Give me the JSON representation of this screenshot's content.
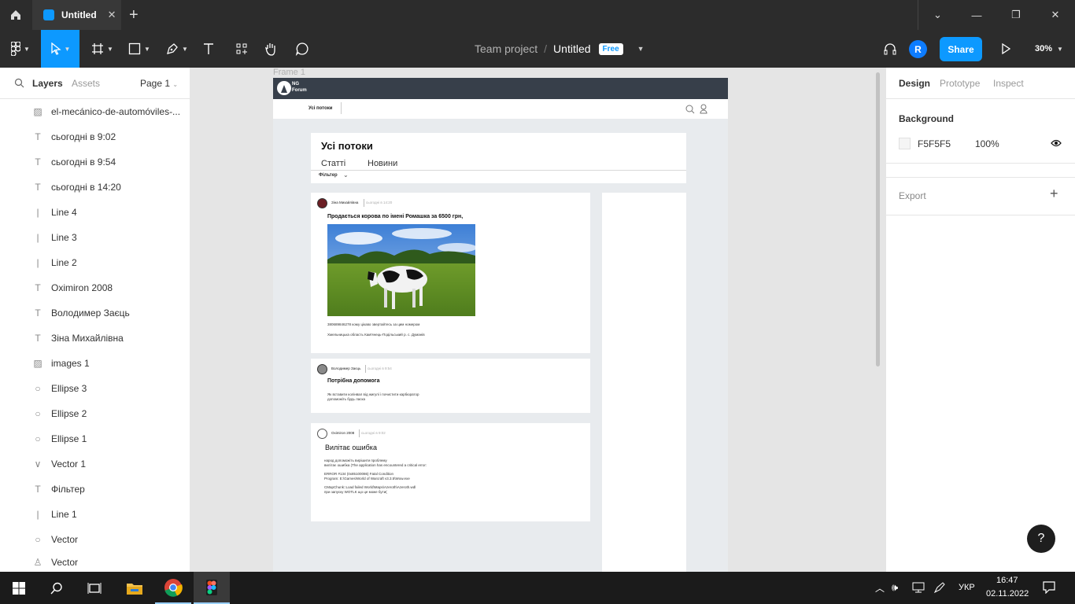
{
  "titlebar": {
    "tab_label": "Untitled",
    "tab_close": "✕",
    "new_tab": "+",
    "min": "—",
    "max": "❐",
    "close": "✕"
  },
  "toolbar": {
    "team": "Team project",
    "sep": "/",
    "file": "Untitled",
    "plan_badge": "Free",
    "avatar_initial": "R",
    "share_label": "Share",
    "zoom": "30%"
  },
  "left_panel": {
    "tab_layers": "Layers",
    "tab_assets": "Assets",
    "page": "Page 1",
    "layers": [
      {
        "icon": "image-icon",
        "label": "el-mecánico-de-automóviles-..."
      },
      {
        "icon": "text-icon",
        "label": "сьогодні в 9:02"
      },
      {
        "icon": "text-icon",
        "label": "сьогодні в 9:54"
      },
      {
        "icon": "text-icon",
        "label": "сьогодні в 14:20"
      },
      {
        "icon": "line-icon",
        "label": "Line 4"
      },
      {
        "icon": "line-icon",
        "label": "Line 3"
      },
      {
        "icon": "line-icon",
        "label": "Line 2"
      },
      {
        "icon": "text-icon",
        "label": "Oximiron 2008"
      },
      {
        "icon": "text-icon",
        "label": "Володимер Заєць"
      },
      {
        "icon": "text-icon",
        "label": "Зіна Михайлівна"
      },
      {
        "icon": "image-icon",
        "label": "images 1"
      },
      {
        "icon": "ellipse-icon",
        "label": "Ellipse 3"
      },
      {
        "icon": "ellipse-icon",
        "label": "Ellipse 2"
      },
      {
        "icon": "ellipse-icon",
        "label": "Ellipse 1"
      },
      {
        "icon": "vector-icon",
        "label": "Vector 1"
      },
      {
        "icon": "text-icon",
        "label": "Фільтер"
      },
      {
        "icon": "line-icon",
        "label": "Line 1"
      },
      {
        "icon": "search-icon",
        "label": "Vector"
      },
      {
        "icon": "user-icon",
        "label": "Vector"
      }
    ]
  },
  "canvas": {
    "frame_label": "Frame 1",
    "site": {
      "logo_line1": "NG",
      "logo_line2": "Forum",
      "nav_all": "Усі потоки",
      "page_title": "Усі потоки",
      "tab_articles": "Статті",
      "tab_news": "Новини",
      "filter": "Фільтер",
      "posts": [
        {
          "author": "Зіна Михайлівна",
          "time": "сьогодні в 14:20",
          "title": "Продається корова по імені Ромашка за 6500 грн,",
          "line1": "380689846278 кому цікаво звертайтесь за цим номером",
          "line2": "Хмельницька область Кам'янець-Подільський р. с. Думанів"
        },
        {
          "author": "Володимер Заєць",
          "time": "сьогодні в 9:54",
          "title": "Потрібна допомога",
          "line1": "Як вставити колінвал від жигулі і почистити карбюратор",
          "line2": "допоможіть будь ласка"
        },
        {
          "author": "Oximiron 2008",
          "time": "сьогодні в 9:02",
          "title": "Вилітає ошибка",
          "line1": "народ допоможіть вирішити проблему",
          "line2": "вилітає ошибка (The application has encountered a critical error:",
          "line3": "ERROR #134 (0x85100086) Fatal Condition",
          "line4": "Program: E:\\Games\\World of Warcraft v3.3.5\\Wow.exe",
          "line5": "CMapChunk::Load failed World\\Maps\\Azeroth\\Azeroth.wdl",
          "line6": "при запуску WOTLK що це може бути("
        }
      ]
    }
  },
  "right_panel": {
    "tab_design": "Design",
    "tab_prototype": "Prototype",
    "tab_inspect": "Inspect",
    "background_heading": "Background",
    "bg_hex": "F5F5F5",
    "bg_opacity": "100%",
    "export_label": "Export",
    "export_add": "+"
  },
  "help": "?",
  "taskbar": {
    "lang": "УКР",
    "time": "16:47",
    "date": "02.11.2022"
  },
  "colors": {
    "accent": "#0d99ff",
    "dark": "#2c2c2c",
    "site_header": "#373f4a",
    "frame_bg": "#e8ebee"
  }
}
